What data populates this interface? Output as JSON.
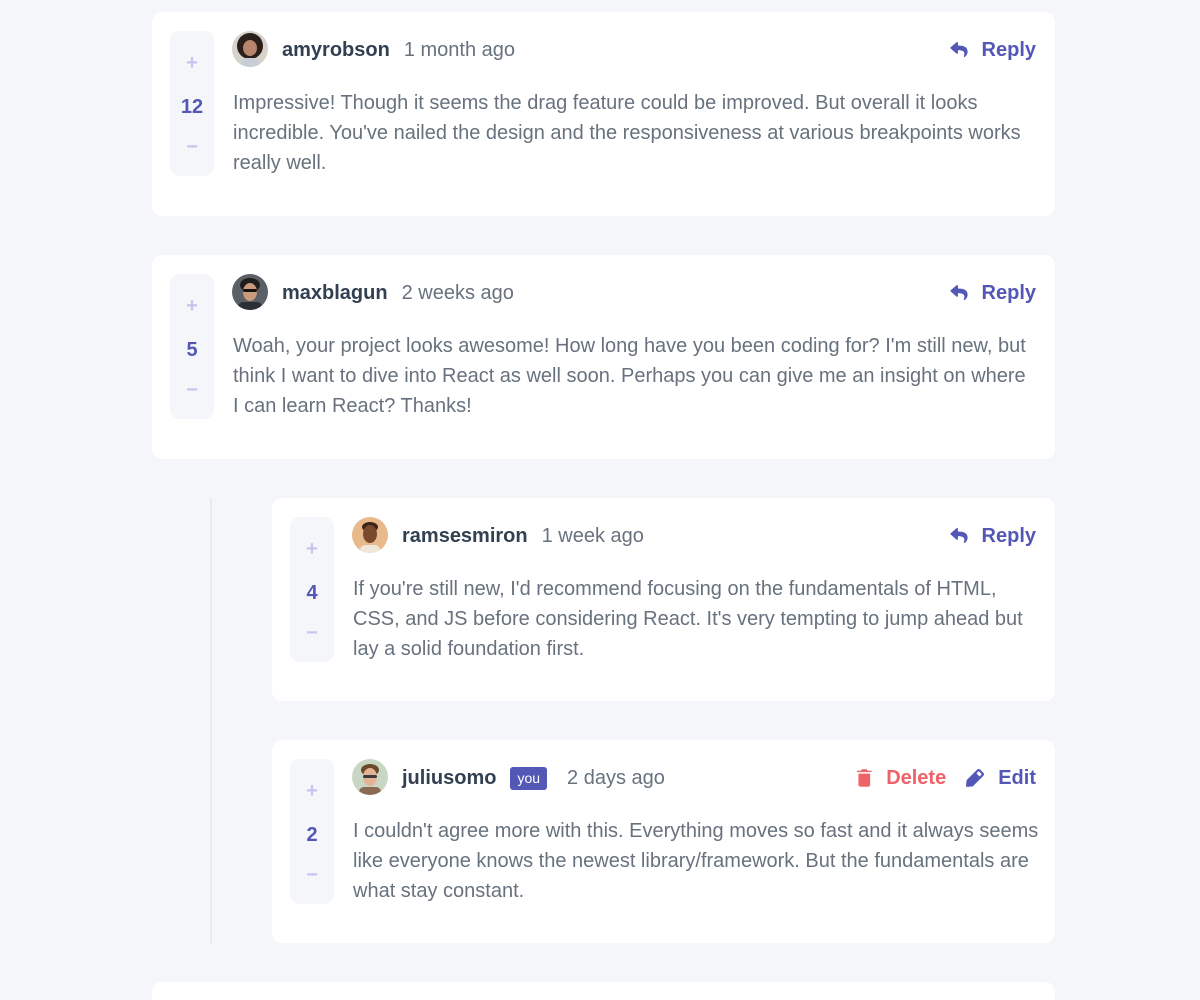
{
  "comments": [
    {
      "username": "amyrobson",
      "time": "1 month ago",
      "score": "12",
      "plus": "+",
      "minus": "−",
      "text": "Impressive! Though it seems the drag feature could be improved. But overall it looks incredible. You've nailed the design and the responsiveness at various breakpoints works really well.",
      "reply_label": "Reply"
    },
    {
      "username": "maxblagun",
      "time": "2 weeks ago",
      "score": "5",
      "plus": "+",
      "minus": "−",
      "text": "Woah, your project looks awesome! How long have you been coding for? I'm still new, but think I want to dive into React as well soon. Perhaps you can give me an insight on where I can learn React? Thanks!",
      "reply_label": "Reply"
    }
  ],
  "replies": [
    {
      "username": "ramsesmiron",
      "time": "1 week ago",
      "score": "4",
      "plus": "+",
      "minus": "−",
      "text": "If you're still new, I'd recommend focusing on the fundamentals of HTML, CSS, and JS before considering React. It's very tempting to jump ahead but lay a solid foundation first.",
      "reply_label": "Reply"
    },
    {
      "username": "juliusomo",
      "badge": "you",
      "time": "2 days ago",
      "score": "2",
      "plus": "+",
      "minus": "−",
      "text": "I couldn't agree more with this. Everything moves so fast and it always seems like everyone knows the newest library/framework. But the fundamentals are what stay constant.",
      "delete_label": "Delete",
      "edit_label": "Edit"
    }
  ],
  "icons": {
    "reply": "reply-icon",
    "delete": "trash-icon",
    "edit": "pencil-icon"
  },
  "colors": {
    "accent": "#5357b6",
    "danger": "#ed6368",
    "text": "#67727e",
    "heading": "#324152",
    "vote_light": "#c5c6ef",
    "background": "#f5f6fa"
  }
}
